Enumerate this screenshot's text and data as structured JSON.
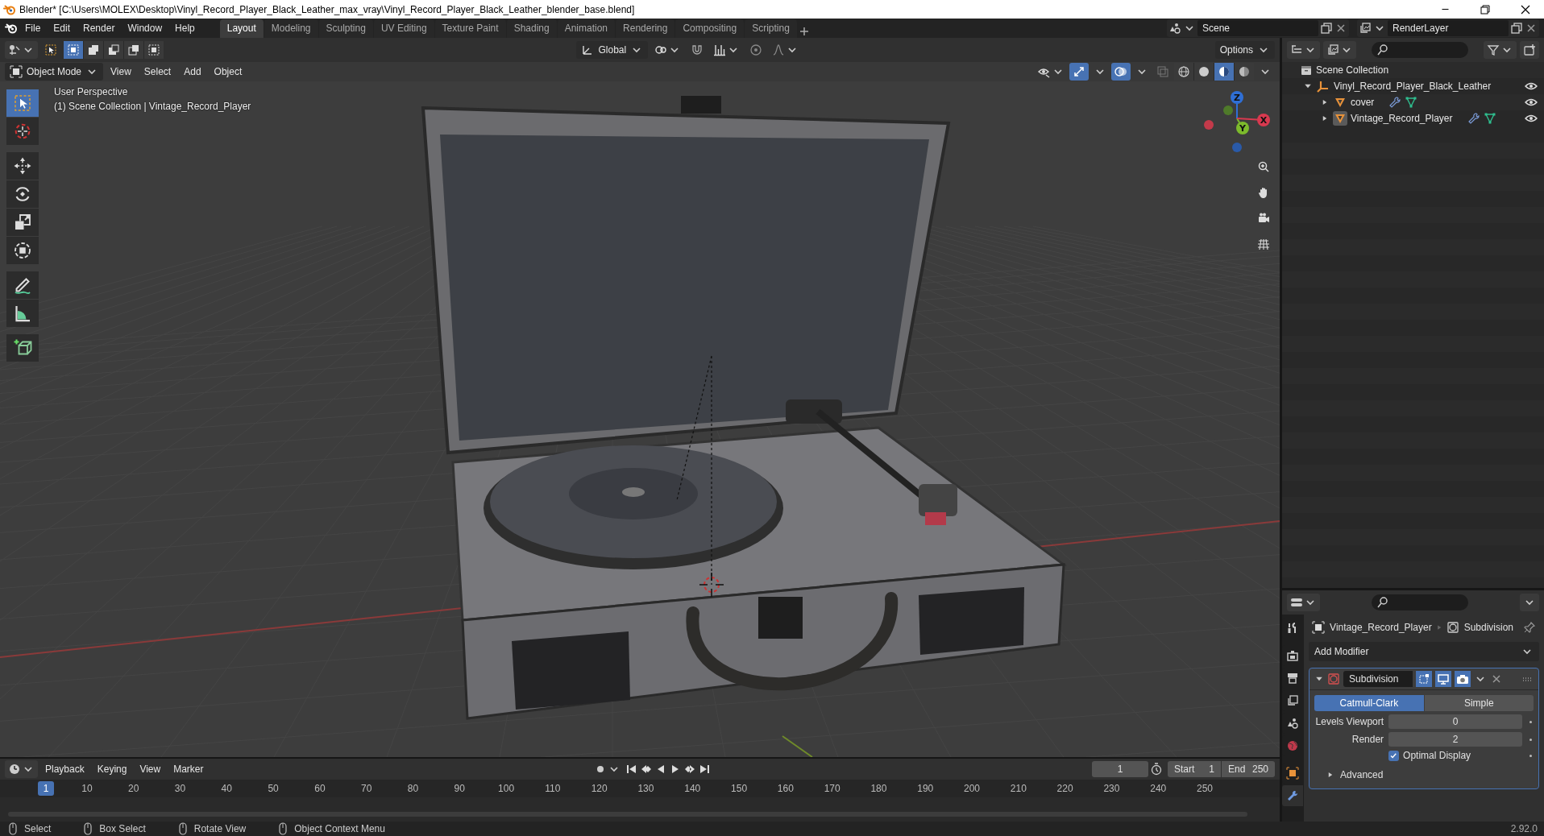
{
  "window": {
    "title": "Blender* [C:\\Users\\MOLEX\\Desktop\\Vinyl_Record_Player_Black_Leather_max_vray\\Vinyl_Record_Player_Black_Leather_blender_base.blend]"
  },
  "menu": [
    "File",
    "Edit",
    "Render",
    "Window",
    "Help"
  ],
  "workspaces": [
    {
      "label": "Layout",
      "selected": true
    },
    {
      "label": "Modeling",
      "selected": false
    },
    {
      "label": "Sculpting",
      "selected": false
    },
    {
      "label": "UV Editing",
      "selected": false
    },
    {
      "label": "Texture Paint",
      "selected": false
    },
    {
      "label": "Shading",
      "selected": false
    },
    {
      "label": "Animation",
      "selected": false
    },
    {
      "label": "Rendering",
      "selected": false
    },
    {
      "label": "Compositing",
      "selected": false
    },
    {
      "label": "Scripting",
      "selected": false
    }
  ],
  "scene": "Scene",
  "view_layer": "RenderLayer",
  "tool_header": {
    "select_modes": [
      {
        "kind": "set",
        "selected": true
      },
      {
        "kind": "extend",
        "selected": false
      },
      {
        "kind": "subtract",
        "selected": false
      },
      {
        "kind": "invert",
        "selected": false
      },
      {
        "kind": "intersect",
        "selected": false
      }
    ],
    "orientation": "Global",
    "options": "Options"
  },
  "viewport": {
    "mode": "Object Mode",
    "menus": [
      "View",
      "Select",
      "Add",
      "Object"
    ],
    "show_gizmo": true,
    "show_overlays": true,
    "shading": [
      {
        "kind": "wireframe",
        "selected": false
      },
      {
        "kind": "solid",
        "selected": false
      },
      {
        "kind": "material",
        "selected": true
      },
      {
        "kind": "rendered",
        "selected": false
      }
    ],
    "view_name": "User Perspective",
    "context": "(1) Scene Collection | Vintage_Record_Player",
    "tools": [
      {
        "kind": "select",
        "selected": true
      },
      {
        "kind": "cursor",
        "selected": false
      },
      {
        "kind": "move",
        "selected": false
      },
      {
        "kind": "rotate",
        "selected": false
      },
      {
        "kind": "scale",
        "selected": false
      },
      {
        "kind": "transform",
        "selected": false
      },
      {
        "kind": "annotate",
        "selected": false
      },
      {
        "kind": "measure",
        "selected": false
      },
      {
        "kind": "add_cube",
        "selected": false
      }
    ],
    "gizmo": [
      {
        "kind": "z",
        "label": "Z"
      },
      {
        "kind": "y",
        "label": "Y"
      },
      {
        "kind": "x",
        "label": "X"
      }
    ]
  },
  "outliner": {
    "root": "Scene Collection",
    "items": [
      {
        "label": "Vinyl_Record_Player_Black_Leather",
        "kind": "collection",
        "expanded": true,
        "selected": false,
        "children": [
          {
            "label": "cover",
            "kind": "mesh",
            "expanded": false,
            "selected": false
          },
          {
            "label": "Vintage_Record_Player",
            "kind": "mesh",
            "expanded": false,
            "selected": true
          }
        ]
      }
    ]
  },
  "properties": {
    "tabs": [
      {
        "kind": "tool",
        "selected": false
      },
      {
        "kind": "render",
        "selected": false
      },
      {
        "kind": "output",
        "selected": false
      },
      {
        "kind": "view_layer",
        "selected": false
      },
      {
        "kind": "scene",
        "selected": false
      },
      {
        "kind": "world",
        "selected": false
      },
      {
        "kind": "object",
        "selected": false
      },
      {
        "kind": "modifier",
        "selected": true
      }
    ],
    "object": "Vintage_Record_Player",
    "context": "Subdivision",
    "add_modifier": "Add Modifier",
    "modifier": {
      "name": "Subdivision",
      "expanded": true,
      "edit_mode": true,
      "show_viewport": true,
      "show_render": true,
      "methods": [
        {
          "label": "Catmull-Clark",
          "selected": true
        },
        {
          "label": "Simple",
          "selected": false
        }
      ],
      "fields": [
        {
          "label": "Levels Viewport",
          "value": "0"
        },
        {
          "label": "Render",
          "value": "2"
        }
      ],
      "optimal_display": {
        "label": "Optimal Display",
        "checked": true
      },
      "advanced": {
        "label": "Advanced",
        "expanded": false
      }
    }
  },
  "timeline": {
    "menus": [
      "Playback",
      "Keying",
      "View",
      "Marker"
    ],
    "current_frame": "1",
    "start_label": "Start",
    "start": "1",
    "end_label": "End",
    "end": "250",
    "playhead": "1",
    "ticks": [
      "10",
      "20",
      "30",
      "40",
      "50",
      "60",
      "70",
      "80",
      "90",
      "100",
      "110",
      "120",
      "130",
      "140",
      "150",
      "160",
      "170",
      "180",
      "190",
      "200",
      "210",
      "220",
      "230",
      "240",
      "250"
    ]
  },
  "status_bar": {
    "hints": [
      "Select",
      "Box Select",
      "Rotate View",
      "Object Context Menu"
    ],
    "version": "2.92.0"
  }
}
